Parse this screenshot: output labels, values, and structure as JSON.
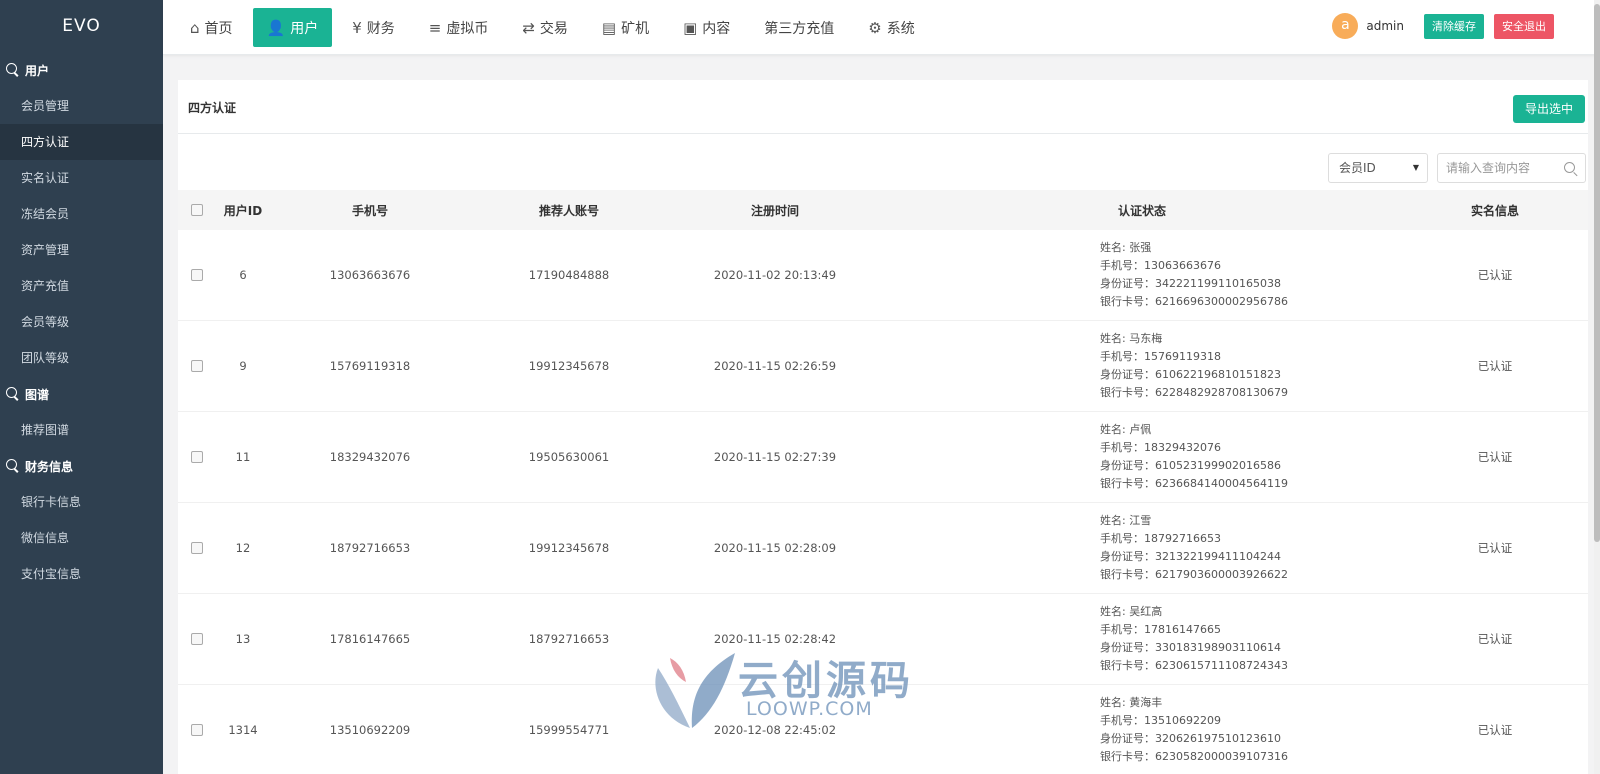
{
  "brand": "EVO",
  "sidebar": {
    "groups": [
      {
        "title": "用户",
        "items": [
          "会员管理",
          "四方认证",
          "实名认证",
          "冻结会员",
          "资产管理",
          "资产充值",
          "会员等级",
          "团队等级"
        ]
      },
      {
        "title": "图谱",
        "items": [
          "推荐图谱"
        ]
      },
      {
        "title": "财务信息",
        "items": [
          "银行卡信息",
          "微信信息",
          "支付宝信息"
        ]
      }
    ]
  },
  "nav": [
    {
      "label": "首页",
      "icon": "home-icon",
      "glyph": "⌂"
    },
    {
      "label": "用户",
      "icon": "user-icon",
      "glyph": "👤"
    },
    {
      "label": "财务",
      "icon": "finance-icon",
      "glyph": "¥"
    },
    {
      "label": "虚拟币",
      "icon": "database-icon",
      "glyph": "≡"
    },
    {
      "label": "交易",
      "icon": "exchange-icon",
      "glyph": "⇄"
    },
    {
      "label": "矿机",
      "icon": "server-icon",
      "glyph": "▤"
    },
    {
      "label": "内容",
      "icon": "document-icon",
      "glyph": "▣"
    },
    {
      "label": "第三方充值",
      "icon": "",
      "glyph": ""
    },
    {
      "label": "系统",
      "icon": "gear-icon",
      "glyph": "⚙"
    }
  ],
  "user": {
    "avatar_letter": "a",
    "name": "admin",
    "clear_cache": "清除缓存",
    "logout": "安全退出"
  },
  "page": {
    "title": "四方认证",
    "export_button": "导出选中"
  },
  "filter": {
    "select_value": "会员ID",
    "search_placeholder": "请输入查询内容"
  },
  "table": {
    "headers": {
      "id": "用户ID",
      "phone": "手机号",
      "referrer": "推荐人账号",
      "reg_time": "注册时间",
      "status": "认证状态",
      "realname": "实名信息"
    },
    "rows": [
      {
        "id": "6",
        "phone": "13063663676",
        "referrer": "17190484888",
        "reg_time": "2020-11-02 20:13:49",
        "name": "姓名: 张强",
        "mobile": "手机号：13063663676",
        "idcard": "身份证号：342221199110165038",
        "bankcard": "银行卡号：6216696300002956786",
        "realname": "已认证"
      },
      {
        "id": "9",
        "phone": "15769119318",
        "referrer": "19912345678",
        "reg_time": "2020-11-15 02:26:59",
        "name": "姓名: 马东梅",
        "mobile": "手机号：15769119318",
        "idcard": "身份证号：610622196810151823",
        "bankcard": "银行卡号：6228482928708130679",
        "realname": "已认证"
      },
      {
        "id": "11",
        "phone": "18329432076",
        "referrer": "19505630061",
        "reg_time": "2020-11-15 02:27:39",
        "name": "姓名: 卢佩",
        "mobile": "手机号：18329432076",
        "idcard": "身份证号：610523199902016586",
        "bankcard": "银行卡号：6236684140004564119",
        "realname": "已认证"
      },
      {
        "id": "12",
        "phone": "18792716653",
        "referrer": "19912345678",
        "reg_time": "2020-11-15 02:28:09",
        "name": "姓名: 江雪",
        "mobile": "手机号：18792716653",
        "idcard": "身份证号：321322199411104244",
        "bankcard": "银行卡号：6217903600003926622",
        "realname": "已认证"
      },
      {
        "id": "13",
        "phone": "17816147665",
        "referrer": "18792716653",
        "reg_time": "2020-11-15 02:28:42",
        "name": "姓名: 吴红高",
        "mobile": "手机号：17816147665",
        "idcard": "身份证号：330183198903110614",
        "bankcard": "银行卡号：6230615711108724343",
        "realname": "已认证"
      },
      {
        "id": "1314",
        "phone": "13510692209",
        "referrer": "15999554771",
        "reg_time": "2020-12-08 22:45:02",
        "name": "姓名: 黄海丰",
        "mobile": "手机号：13510692209",
        "idcard": "身份证号：320626197510123610",
        "bankcard": "银行卡号：6230582000039107316",
        "realname": "已认证"
      }
    ]
  },
  "watermark": {
    "cn": "云创源码",
    "en": "LOOWP.COM"
  },
  "colors": {
    "sidebar": "#2f4050",
    "accent": "#1ab394",
    "danger": "#ed5565",
    "avatar": "#f8ac59"
  }
}
